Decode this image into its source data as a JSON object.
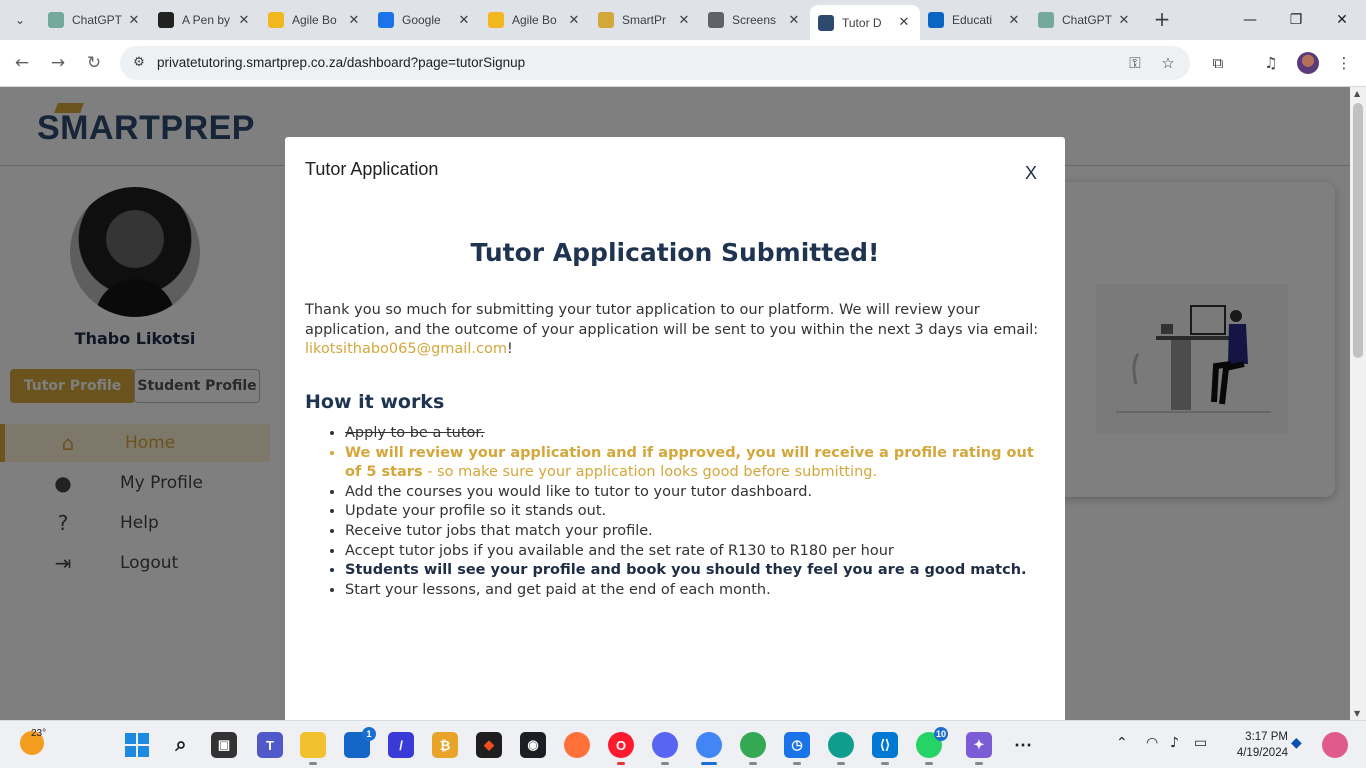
{
  "browser": {
    "tabs": [
      {
        "label": "ChatGPT",
        "icon": "chatgpt-icon",
        "color": "#74aa9c"
      },
      {
        "label": "A Pen by",
        "icon": "codepen-icon",
        "color": "#222222"
      },
      {
        "label": "Agile Bo",
        "icon": "sparkle-icon",
        "color": "#f2b61e"
      },
      {
        "label": "Google",
        "icon": "google-calendar-icon",
        "color": "#1a73e8"
      },
      {
        "label": "Agile Bo",
        "icon": "sparkle-icon",
        "color": "#f2b61e"
      },
      {
        "label": "SmartPr",
        "icon": "smartprep-icon",
        "color": "#d4a73a"
      },
      {
        "label": "Screens",
        "icon": "globe-icon",
        "color": "#5f6368"
      },
      {
        "label": "Tutor D",
        "icon": "smartprep-icon",
        "color": "#2d4a6e"
      },
      {
        "label": "Educati",
        "icon": "linkedin-icon",
        "color": "#0a66c2"
      },
      {
        "label": "ChatGPT",
        "icon": "chatgpt-icon",
        "color": "#74aa9c"
      }
    ],
    "active_tab_index": 7,
    "url": "privatetutoring.smartprep.co.za/dashboard?page=tutorSignup"
  },
  "site": {
    "logo_left": "SMART",
    "logo_right": "PREP"
  },
  "sidebar": {
    "user_name": "Thabo Likotsi",
    "tutor_profile_label": "Tutor Profile",
    "student_profile_label": "Student Profile",
    "nav": [
      {
        "label": "Home",
        "icon": "home-icon",
        "active": true
      },
      {
        "label": "My Profile",
        "icon": "user-icon",
        "active": false
      },
      {
        "label": "Help",
        "icon": "help-icon",
        "active": false
      },
      {
        "label": "Logout",
        "icon": "logout-icon",
        "active": false
      }
    ]
  },
  "modal": {
    "title": "Tutor Application",
    "close_label": "X",
    "heading": "Tutor Application Submitted!",
    "message": "Thank you so much for submitting your tutor application to our platform. We will review your application, and the outcome of your application will be sent to you within the next 3 days via email:",
    "email": "likotsithabo065@gmail.com",
    "message_suffix": "!",
    "how_title": "How it works",
    "steps": [
      {
        "text": "Apply to be a tutor.",
        "style": "done"
      },
      {
        "text_bold": "We will review your application and if approved, you will receive a profile rating out of 5 stars",
        "text": " - so make sure your application looks good before submitting.",
        "style": "highlight"
      },
      {
        "text": "Add the courses you would like to tutor to your tutor dashboard.",
        "style": "normal"
      },
      {
        "text": "Update your profile so it stands out.",
        "style": "normal"
      },
      {
        "text": "Receive tutor jobs that match your profile.",
        "style": "normal"
      },
      {
        "text": "Accept tutor jobs if you available and the set rate of R130 to R180 per hour",
        "style": "normal"
      },
      {
        "text": "Students will see your profile and book you should they feel you are a good match.",
        "style": "strong"
      },
      {
        "text": "Start your lessons, and get paid at the end of each month.",
        "style": "normal"
      }
    ]
  },
  "taskbar": {
    "temperature": "23°",
    "time": "3:17 PM",
    "date": "4/19/2024",
    "badges": {
      "store": "1",
      "whatsapp": "10"
    }
  },
  "colors": {
    "brand_gold": "#d4a73a",
    "brand_navy": "#1f3450"
  }
}
